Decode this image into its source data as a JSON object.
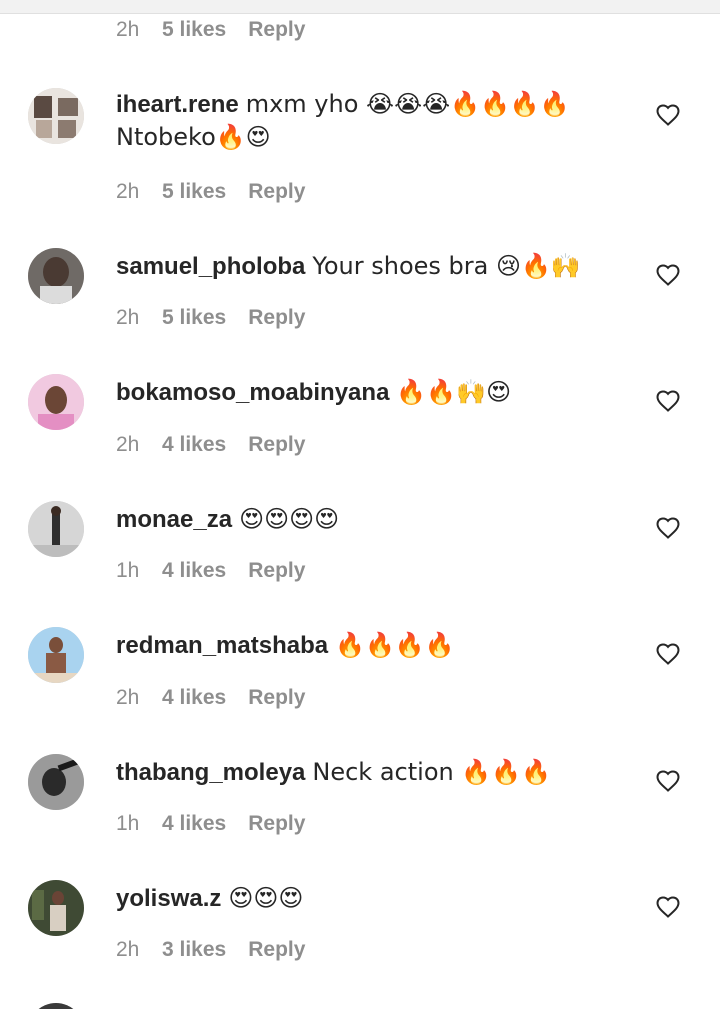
{
  "top_meta": {
    "time": "2h",
    "likes": "5 likes",
    "reply": "Reply"
  },
  "comments": [
    {
      "username": "iheart.rene",
      "text": "mxm yho 😭😭😭🔥🔥🔥🔥 Ntobeko🔥😍",
      "time": "2h",
      "likes": "5 likes",
      "reply": "Reply"
    },
    {
      "username": "samuel_pholoba",
      "text": "Your shoes bra 😢🔥🙌",
      "time": "2h",
      "likes": "5 likes",
      "reply": "Reply"
    },
    {
      "username": "bokamoso_moabinyana",
      "text": "🔥🔥🙌😍",
      "time": "2h",
      "likes": "4 likes",
      "reply": "Reply"
    },
    {
      "username": "monae_za",
      "text": "😍😍😍😍",
      "time": "1h",
      "likes": "4 likes",
      "reply": "Reply"
    },
    {
      "username": "redman_matshaba",
      "text": "🔥🔥🔥🔥",
      "time": "2h",
      "likes": "4 likes",
      "reply": "Reply"
    },
    {
      "username": "thabang_moleya",
      "text": "Neck action 🔥🔥🔥",
      "time": "1h",
      "likes": "4 likes",
      "reply": "Reply"
    },
    {
      "username": "yoliswa.z",
      "text": "😍😍😍",
      "time": "2h",
      "likes": "3 likes",
      "reply": "Reply"
    }
  ],
  "icons": {
    "like": "heart-outline-icon"
  },
  "colors": {
    "text": "#262626",
    "meta": "#8e8e8e"
  }
}
